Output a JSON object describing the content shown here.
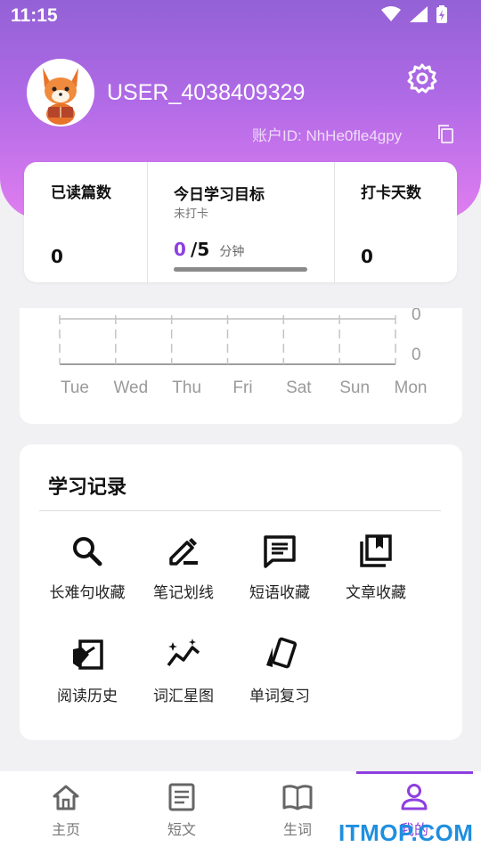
{
  "status_bar": {
    "time": "11:15"
  },
  "profile": {
    "username": "USER_4038409329",
    "account_id": "账户ID: NhHe0fle4gpy"
  },
  "stats": {
    "articles_read": {
      "title": "已读篇数",
      "value": "0"
    },
    "daily_goal": {
      "title": "今日学习目标",
      "status": "未打卡",
      "done": "0",
      "total": "/5",
      "unit": "分钟",
      "progress_fraction": 0
    },
    "checkin_days": {
      "title": "打卡天数",
      "value": "0"
    }
  },
  "chart_data": {
    "type": "bar",
    "categories": [
      "Tue",
      "Wed",
      "Thu",
      "Fri",
      "Sat",
      "Sun",
      "Mon"
    ],
    "values": [
      0,
      0,
      0,
      0,
      0,
      0,
      0
    ],
    "right_axis_labels": [
      "0",
      "0"
    ]
  },
  "records": {
    "title": "学习记录",
    "items": [
      {
        "label": "长难句收藏",
        "icon": "search-icon"
      },
      {
        "label": "笔记划线",
        "icon": "edit-pen-icon"
      },
      {
        "label": "短语收藏",
        "icon": "message-icon"
      },
      {
        "label": "文章收藏",
        "icon": "bookmarks-icon"
      },
      {
        "label": "阅读历史",
        "icon": "history-icon"
      },
      {
        "label": "词汇星图",
        "icon": "star-graph-icon"
      },
      {
        "label": "单词复习",
        "icon": "cards-icon"
      }
    ]
  },
  "nav": {
    "items": [
      {
        "label": "主页",
        "icon": "home-icon"
      },
      {
        "label": "短文",
        "icon": "article-icon"
      },
      {
        "label": "生词",
        "icon": "book-icon"
      },
      {
        "label": "我的",
        "icon": "person-icon"
      }
    ],
    "active_index": 3
  },
  "watermark": "ITMOP.COM",
  "colors": {
    "accent": "#8e3fe0",
    "header_top": "#9361d6",
    "header_bottom": "#e07ef0"
  }
}
